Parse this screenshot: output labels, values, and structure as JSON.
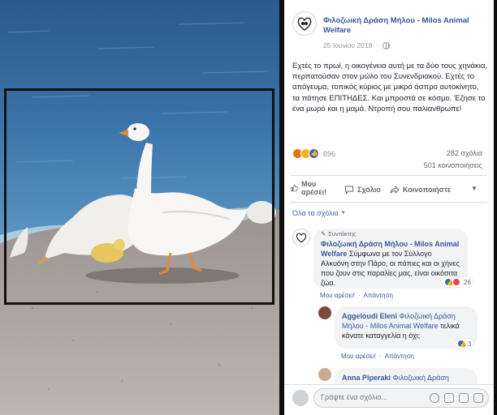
{
  "post": {
    "page_name": "Φιλοζωική Δράση Μήλου - Milos Animal Welfare",
    "date": "25 Ιουνίου 2019",
    "privacy_icon": "globe-icon",
    "text": "Εχτές το πρωί, η οικογένεια αυτή με τα δύο τους χηνάκια, περπατούσαν στον μώλο του Συνενδριακού. Εχτές το απόγευμα, τοπικός κύριος με μικρό άσπρο αυτοκίνητο, τα πάτησε ΕΠΙΤΗΔΕΣ. Και μπροστά σε κόσμο. Έζησε το ένα μωρό και η μαμά. Ντροπή σου παλιανθρωπε!",
    "reaction_count": "896",
    "reaction_types": [
      "angry",
      "sad",
      "like"
    ],
    "comments_count": "282 σχόλια",
    "shares_count": "501 κοινοποιήσεις"
  },
  "actions": {
    "like_label": "Μου αρέσει!",
    "comment_label": "Σχόλιο",
    "share_label": "Κοινοποιήστε"
  },
  "comments_sort_label": "Όλα τα σχόλια",
  "comments": [
    {
      "role": "Συντάκτης",
      "author": "Φιλοζωική Δράση Μήλου - Milos Animal Welfare",
      "text": "Σύμφωνα με τον Σύλλογο Αλκυόνη στην Πάρο, οι πάπιες και οι χήνες που ζουν στις παραλίες μας, είναι οικόσιτα ζώα.",
      "reaction_count": "26",
      "like_link": "Μου αρέσει!",
      "reply_link": "Απάντηση"
    },
    {
      "author": "Aggeloudi Eleni",
      "mention": "Φιλοζωική Δράση Μήλου - Milos Animal Welfare",
      "text": "τελικά κάνατε καταγγελία η όχι;",
      "reaction_count": "3",
      "like_link": "Μου αρέσει!",
      "reply_link": "Απάντηση"
    },
    {
      "author": "Anna Piperaki",
      "mention": "Φιλοζωική Δράση"
    }
  ],
  "composer": {
    "placeholder": "Γράψτε ένα σχόλιο..."
  },
  "colors": {
    "link_blue": "#365899",
    "accent": "#4267b2",
    "bubble_gray": "#f2f3f5"
  }
}
